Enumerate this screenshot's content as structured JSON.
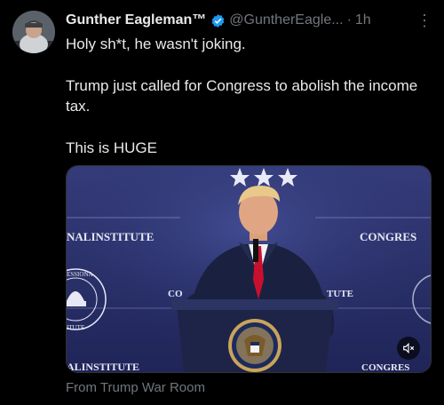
{
  "author": {
    "name": "Gunther Eagleman™",
    "handle": "@GuntherEagle...",
    "time": "1h",
    "verified": true
  },
  "tweet": {
    "lines": [
      "Holy sh*t, he wasn't joking.",
      "Trump just called for Congress to abolish the income tax.",
      "This is HUGE"
    ]
  },
  "media": {
    "banner_left": "NALINSTITUTE",
    "banner_right": "CONGRES",
    "banner_left_bottom": "ALINSTITUTE",
    "banner_right_bottom": "CONGRES",
    "mid_left": "CO",
    "mid_right": "TUTE",
    "seal_text_top": "ESSIONA",
    "seal_text_bottom": "ITUTE"
  },
  "footer": {
    "source": "From Trump War Room"
  },
  "colors": {
    "background": "#000000",
    "text": "#e7e9ea",
    "muted": "#71767b",
    "verified": "#1d9bf0",
    "stage_blue": "#2a3370"
  },
  "icons": {
    "verified": "verified-badge-icon",
    "more": "more-options-icon",
    "mute": "mute-icon"
  }
}
